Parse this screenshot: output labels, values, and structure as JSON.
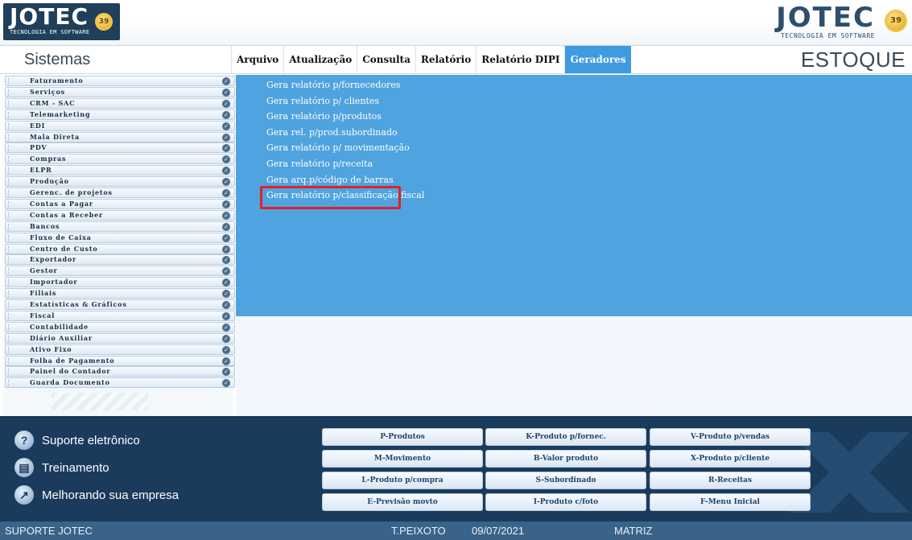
{
  "header": {
    "logo_left": {
      "word": "JOTEC",
      "tagline": "TECNOLOGIA EM SOFTWARE",
      "seal": "39"
    },
    "logo_right": {
      "word": "JOTEC",
      "tagline": "TECNOLOGIA EM SOFTWARE",
      "seal": "39"
    }
  },
  "title": {
    "left": "Sistemas",
    "right": "ESTOQUE"
  },
  "menu": [
    {
      "label": "Arquivo",
      "active": false
    },
    {
      "label": "Atualização",
      "active": false
    },
    {
      "label": "Consulta",
      "active": false
    },
    {
      "label": "Relatório",
      "active": false
    },
    {
      "label": "Relatório DIPI",
      "active": false
    },
    {
      "label": "Geradores",
      "active": true
    }
  ],
  "sidebar": {
    "items": [
      "Faturamento",
      "Serviços",
      "CRM - SAC",
      "Telemarketing",
      "EDI",
      "Mala Direta",
      "PDV",
      "Compras",
      "ELPR",
      "Produção",
      "Gerenc. de projetos",
      "Contas a Pagar",
      "Contas a Receber",
      "Bancos",
      "Fluxo de Caixa",
      "Centro de Custo",
      "Exportador",
      "Gestor",
      "Importador",
      "Filiais",
      "Estatísticas & Gráficos",
      "Fiscal",
      "Contabilidade",
      "Diário Auxiliar",
      "Ativo Fixo",
      "Folha de Pagamento",
      "Painel do Contador",
      "Guarda Documento"
    ]
  },
  "generators": [
    "Gera relatório p/fornecedores",
    "Gera relatório p/ clientes",
    "Gera relatório p/produtos",
    "Gera rel. p/prod.subordinado",
    "Gera relatório p/ movimentação",
    "Gera relatório p/receita",
    "Gera arq.p/código de barras",
    "Gera relatório p/classificação fiscal"
  ],
  "highlighted_generator": "Gera relatório p/classificação fiscal",
  "support": [
    {
      "label": "Suporte eletrônico",
      "icon": "help-icon"
    },
    {
      "label": "Treinamento",
      "icon": "training-icon"
    },
    {
      "label": "Melhorando sua empresa",
      "icon": "growth-chart-icon"
    }
  ],
  "shortcuts": [
    [
      "P-Produtos",
      "K-Produto p/fornec.",
      "V-Produto p/vendas"
    ],
    [
      "M-Movimento",
      "B-Valor produto",
      "X-Produto p/cliente"
    ],
    [
      "L-Produto p/compra",
      "S-Subordinado",
      "R-Receitas"
    ],
    [
      "E-Previsão movto",
      "I-Produto c/foto",
      "F-Menu Inicial"
    ]
  ],
  "status": {
    "left": "SUPORTE JOTEC",
    "user": "T.PEIXOTO",
    "date": "09/07/2021",
    "branch": "MATRIZ"
  },
  "colors": {
    "menu_active": "#3f9be0",
    "content_blue": "#4fa3df",
    "bottom_panel": "#1b3b5c",
    "status_bar": "#3a6389",
    "highlight": "#e12228"
  }
}
